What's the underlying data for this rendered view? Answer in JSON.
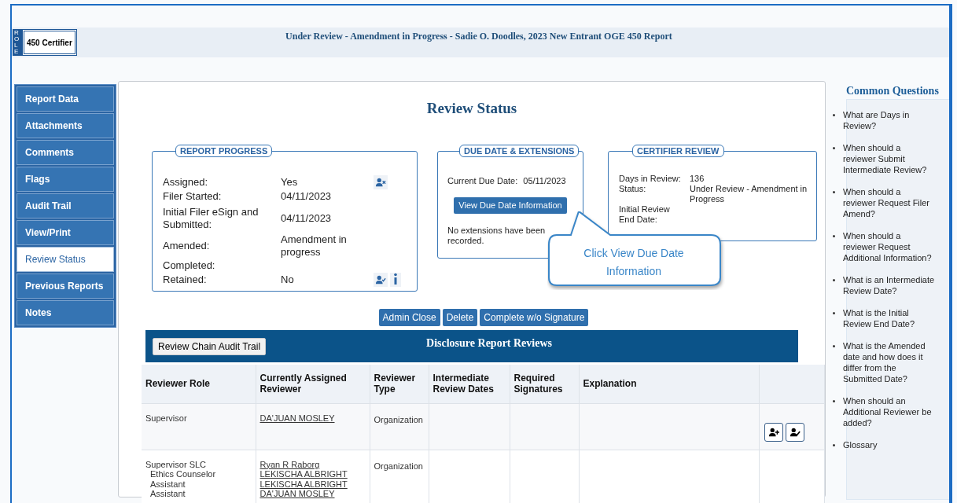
{
  "role_badge": {
    "label": "ROLE",
    "role": "450 Certifier"
  },
  "page_title": "Under Review - Amendment in Progress - Sadie O. Doodles, 2023 New Entrant OGE 450 Report",
  "nav": [
    {
      "label": "Report Data",
      "selected": false
    },
    {
      "label": "Attachments",
      "selected": false
    },
    {
      "label": "Comments",
      "selected": false
    },
    {
      "label": "Flags",
      "selected": false
    },
    {
      "label": "Audit Trail",
      "selected": false
    },
    {
      "label": "View/Print",
      "selected": false
    },
    {
      "label": "Review Status",
      "selected": true
    },
    {
      "label": "Previous Reports",
      "selected": false
    },
    {
      "label": "Notes",
      "selected": false
    }
  ],
  "main": {
    "title": "Review Status",
    "report_progress": {
      "title": "REPORT PROGRESS",
      "rows": [
        {
          "label": "Assigned:",
          "value": "Yes"
        },
        {
          "label": "Filer Started:",
          "value": "04/11/2023"
        },
        {
          "label": "Initial Filer eSign and Submitted:",
          "value": "04/11/2023"
        },
        {
          "label": "Amended:",
          "value": "Amendment in progress"
        },
        {
          "label": "Completed:"
        },
        {
          "label": "Retained:",
          "value": "No"
        }
      ]
    },
    "due_date": {
      "title": "DUE DATE & EXTENSIONS",
      "label": "Current Due Date:",
      "value": "05/11/2023",
      "button": "View Due Date Information",
      "note": "No extensions have been recorded."
    },
    "certifier_review": {
      "title": "CERTIFIER REVIEW",
      "rows": [
        {
          "label": "Days in Review:",
          "value": "136"
        },
        {
          "label": "Status:",
          "value": "Under Review - Amendment in Progress"
        },
        {
          "label": "Initial Review End Date:"
        }
      ]
    },
    "callout": "Click View Due Date Information",
    "actions": [
      "Admin Close",
      "Delete",
      "Complete w/o Signature"
    ],
    "reviews": {
      "audit_button": "Review Chain Audit Trail",
      "title": "Disclosure Report Reviews",
      "columns": [
        "Reviewer Role",
        "Currently Assigned Reviewer",
        "Reviewer Type",
        "Intermediate Review Dates",
        "Required Signatures",
        "Explanation"
      ],
      "rows": [
        {
          "role": {
            "label": "Supervisor"
          },
          "reviewers": [
            "DA'JUAN MOSLEY"
          ],
          "type": "Organization",
          "has_actions": true
        },
        {
          "role": {
            "label": "Supervisor SLC",
            "children": [
              {
                "label": "Ethics Counselor"
              },
              {
                "label": "Assistant"
              },
              {
                "label": "Assistant"
              }
            ]
          },
          "reviewers": [
            "Ryan R Raborg",
            "LEKISCHA ALBRIGHT",
            "LEKISCHA ALBRIGHT",
            "DA'JUAN MOSLEY"
          ],
          "type": "Organization",
          "has_actions": false
        }
      ]
    }
  },
  "common_questions": {
    "title": "Common Questions",
    "items": [
      "What are Days in Review?",
      "When should a reviewer Submit Intermediate Review?",
      "When should a reviewer Request Filer Amend?",
      "When should a reviewer Request Additional Information?",
      "What is an Intermediate Review Date?",
      "What is the Initial Review End Date?",
      "What is the Amended date and how does it differ from the Submitted Date?",
      "When should an Additional Reviewer be added?",
      "Glossary"
    ]
  }
}
